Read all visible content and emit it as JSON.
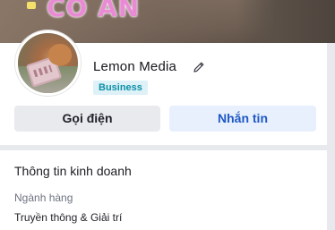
{
  "cover": {
    "text": "CÔ ẢN"
  },
  "profile": {
    "name": "Lemon Media",
    "badge": "Business"
  },
  "actions": {
    "call_label": "Gọi điện",
    "message_label": "Nhắn tin"
  },
  "business_info": {
    "title": "Thông tin kinh doanh",
    "fields": [
      {
        "label": "Ngành hàng",
        "value": "Truyền thông & Giải trí"
      }
    ]
  },
  "colors": {
    "badge_bg": "#ddf1f7",
    "badge_text": "#0e8fa8",
    "message_button_bg": "#e7f0fc",
    "message_button_text": "#1f57c6",
    "call_button_bg": "#e9eaee",
    "divider": "#e8e9ed"
  },
  "icons": {
    "edit": "pencil-icon"
  }
}
